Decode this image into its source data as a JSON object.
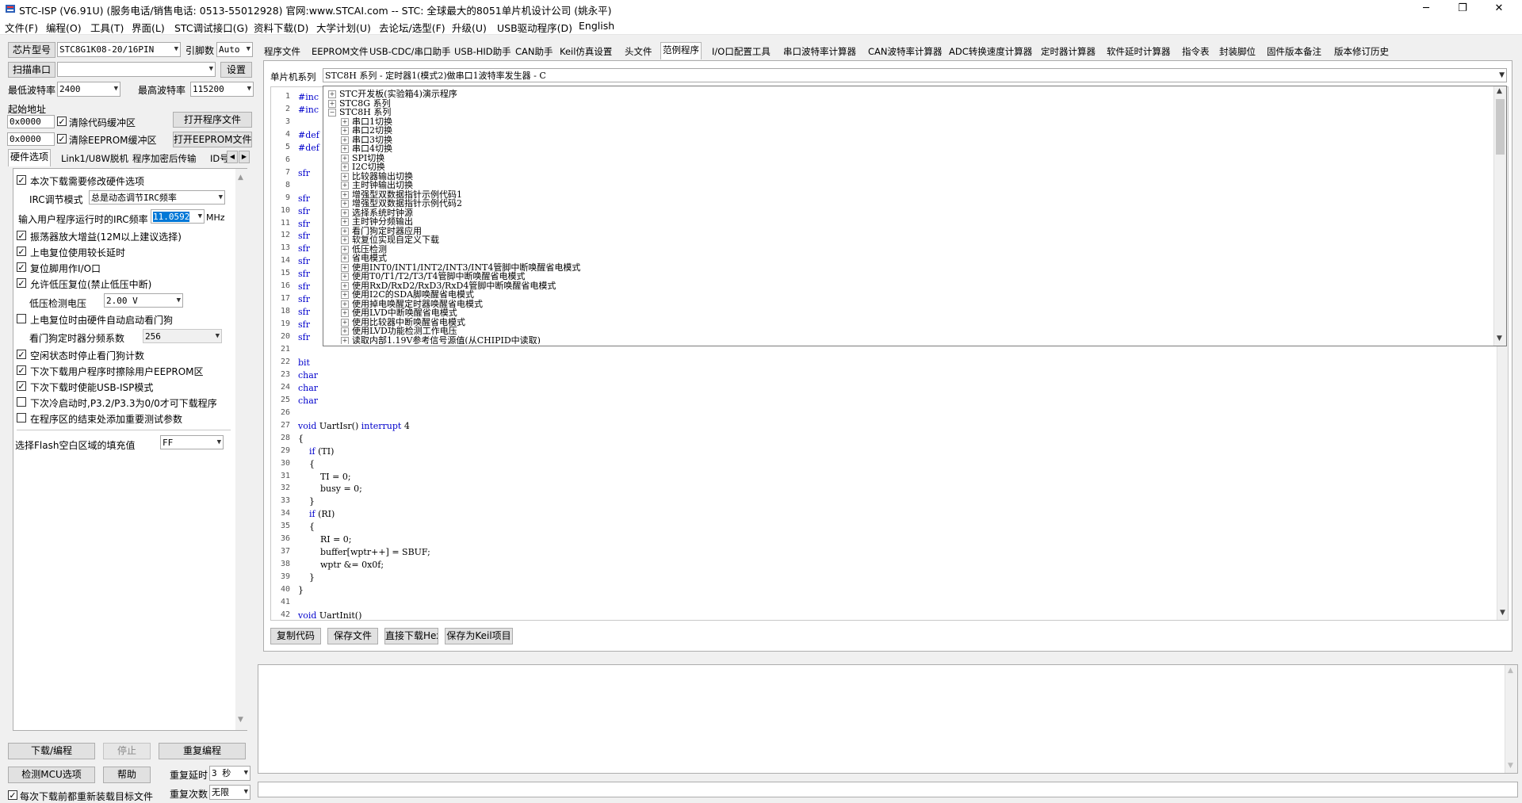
{
  "window": {
    "title": "STC-ISP (V6.91U) (服务电话/销售电话: 0513-55012928) 官网:www.STCAI.com  -- STC: 全球最大的8051单片机设计公司 (姚永平)",
    "minimize": "─",
    "maximize": "❐",
    "close": "✕"
  },
  "menu": [
    "文件(F)",
    "编程(O)",
    "工具(T)",
    "界面(L)",
    "STC调试接口(G)",
    "资料下载(D)",
    "大学计划(U)",
    "去论坛/选型(F)",
    "升级(U)",
    "USB驱动程序(D)",
    "English"
  ],
  "left": {
    "chip_label": "芯片型号",
    "chip_value": "STC8G1K08-20/16PIN",
    "pins_label": "引脚数",
    "pins_value": "Auto",
    "scan_button": "扫描串口",
    "port_value": "",
    "settings_button": "设置",
    "min_baud_label": "最低波特率",
    "min_baud_value": "2400",
    "max_baud_label": "最高波特率",
    "max_baud_value": "115200",
    "start_addr_label": "起始地址",
    "addr1": "0x0000",
    "clear_code": "清除代码缓冲区",
    "open_program": "打开程序文件",
    "addr2": "0x0000",
    "clear_eeprom": "清除EEPROM缓冲区",
    "open_eeprom": "打开EEPROM文件",
    "tabs": [
      "硬件选项",
      "Link1/U8W脱机",
      "程序加密后传输",
      "ID号"
    ],
    "tab_arrows": [
      "◀",
      "▶"
    ],
    "opt_modify_hw": "本次下载需要修改硬件选项",
    "irc_mode_label": "IRC调节模式",
    "irc_mode_value": "总是动态调节IRC频率",
    "irc_freq_label": "输入用户程序运行时的IRC频率",
    "irc_freq_value": "11.0592",
    "irc_freq_unit": "MHz",
    "opt_osc_gain": "振荡器放大增益(12M以上建议选择)",
    "opt_power_delay": "上电复位使用较长延时",
    "opt_reset_io": "复位脚用作I/O口",
    "opt_lvr": "允许低压复位(禁止低压中断)",
    "lvd_label": "低压检测电压",
    "lvd_value": "2.00 V",
    "opt_wdt_hw": "上电复位时由硬件自动启动看门狗",
    "wdt_div_label": "看门狗定时器分频系数",
    "wdt_div_value": "256",
    "opt_idle_wdt": "空闲状态时停止看门狗计数",
    "opt_erase_eeprom": "下次下载用户程序时擦除用户EEPROM区",
    "opt_usb_isp": "下次下载时使能USB-ISP模式",
    "opt_p32p33": "下次冷启动时,P3.2/P3.3为0/0才可下载程序",
    "opt_test_params": "在程序区的结束处添加重要测试参数",
    "flash_fill_label": "选择Flash空白区域的填充值",
    "flash_fill_value": "FF",
    "download_button": "下载/编程",
    "stop_button": "停止",
    "reprogram_button": "重复编程",
    "detect_button": "检测MCU选项",
    "help_button": "帮助",
    "repeat_delay_label": "重复延时",
    "repeat_delay_value": "3 秒",
    "repeat_count_label": "重复次数",
    "repeat_count_value": "无限",
    "reload_label": "每次下载前都重新装载目标文件"
  },
  "right_tabs": [
    "程序文件",
    "EEPROM文件",
    "USB-CDC/串口助手",
    "USB-HID助手",
    "CAN助手",
    "Keil仿真设置",
    "头文件",
    "范例程序",
    "I/O口配置工具",
    "串口波特率计算器",
    "CAN波特率计算器",
    "ADC转换速度计算器",
    "定时器计算器",
    "软件延时计算器",
    "指令表",
    "封装脚位",
    "固件版本备注",
    "版本修订历史"
  ],
  "examples": {
    "series_label": "单片机系列",
    "series_value": "STC8H 系列 - 定时器1(模式2)做串口1波特率发生器 - C",
    "tree": [
      {
        "exp": "+",
        "text": "STC开发板(实验箱4)演示程序",
        "level": 0
      },
      {
        "exp": "+",
        "text": "STC8G 系列",
        "level": 0
      },
      {
        "exp": "−",
        "text": "STC8H 系列",
        "level": 0
      },
      {
        "exp": "+",
        "text": "串口1切换",
        "level": 1
      },
      {
        "exp": "+",
        "text": "串口2切换",
        "level": 1
      },
      {
        "exp": "+",
        "text": "串口3切换",
        "level": 1
      },
      {
        "exp": "+",
        "text": "串口4切换",
        "level": 1
      },
      {
        "exp": "+",
        "text": "SPI切换",
        "level": 1
      },
      {
        "exp": "+",
        "text": "I2C切换",
        "level": 1
      },
      {
        "exp": "+",
        "text": "比较器输出切换",
        "level": 1
      },
      {
        "exp": "+",
        "text": "主时钟输出切换",
        "level": 1
      },
      {
        "exp": "+",
        "text": "增强型双数据指针示例代码1",
        "level": 1
      },
      {
        "exp": "+",
        "text": "增强型双数据指针示例代码2",
        "level": 1
      },
      {
        "exp": "+",
        "text": "选择系统时钟源",
        "level": 1
      },
      {
        "exp": "+",
        "text": "主时钟分频输出",
        "level": 1
      },
      {
        "exp": "+",
        "text": "看门狗定时器应用",
        "level": 1
      },
      {
        "exp": "+",
        "text": "软复位实现自定义下载",
        "level": 1
      },
      {
        "exp": "+",
        "text": "低压检测",
        "level": 1
      },
      {
        "exp": "+",
        "text": "省电模式",
        "level": 1
      },
      {
        "exp": "+",
        "text": "使用INT0/INT1/INT2/INT3/INT4管脚中断唤醒省电模式",
        "level": 1
      },
      {
        "exp": "+",
        "text": "使用T0/T1/T2/T3/T4管脚中断唤醒省电模式",
        "level": 1
      },
      {
        "exp": "+",
        "text": "使用RxD/RxD2/RxD3/RxD4管脚中断唤醒省电模式",
        "level": 1
      },
      {
        "exp": "+",
        "text": "使用I2C的SDA脚唤醒省电模式",
        "level": 1
      },
      {
        "exp": "+",
        "text": "使用掉电唤醒定时器唤醒省电模式",
        "level": 1
      },
      {
        "exp": "+",
        "text": "使用LVD中断唤醒省电模式",
        "level": 1
      },
      {
        "exp": "+",
        "text": "使用比较器中断唤醒省电模式",
        "level": 1
      },
      {
        "exp": "+",
        "text": "使用LVD功能检测工作电压",
        "level": 1
      },
      {
        "exp": "+",
        "text": "读取内部1.19V参考信号源值(从CHIPID中读取)",
        "level": 1
      }
    ],
    "code_lines": [
      {
        "n": "1",
        "t": "#inc",
        "kw": true
      },
      {
        "n": "2",
        "t": "#inc",
        "kw": true
      },
      {
        "n": "3",
        "t": ""
      },
      {
        "n": "4",
        "t": "#def",
        "kw": true
      },
      {
        "n": "5",
        "t": "#def",
        "kw": true
      },
      {
        "n": "6",
        "t": ""
      },
      {
        "n": "7",
        "t": "sfr",
        "kw": true
      },
      {
        "n": "8",
        "t": ""
      },
      {
        "n": "9",
        "t": "sfr",
        "kw": true
      },
      {
        "n": "10",
        "t": "sfr",
        "kw": true
      },
      {
        "n": "11",
        "t": "sfr",
        "kw": true
      },
      {
        "n": "12",
        "t": "sfr",
        "kw": true
      },
      {
        "n": "13",
        "t": "sfr",
        "kw": true
      },
      {
        "n": "14",
        "t": "sfr",
        "kw": true
      },
      {
        "n": "15",
        "t": "sfr",
        "kw": true
      },
      {
        "n": "16",
        "t": "sfr",
        "kw": true
      },
      {
        "n": "17",
        "t": "sfr",
        "kw": true
      },
      {
        "n": "18",
        "t": "sfr",
        "kw": true
      },
      {
        "n": "19",
        "t": "sfr",
        "kw": true
      },
      {
        "n": "20",
        "t": "sfr",
        "kw": true
      },
      {
        "n": "21",
        "t": ""
      },
      {
        "n": "22",
        "t": "bit",
        "kw": true
      },
      {
        "n": "23",
        "t": "char",
        "kw": true
      },
      {
        "n": "24",
        "t": "char",
        "kw": true
      },
      {
        "n": "25",
        "t": "char",
        "kw": true
      },
      {
        "n": "26",
        "t": ""
      },
      {
        "n": "27",
        "t": "void UartIsr() interrupt 4",
        "kw": false
      },
      {
        "n": "28",
        "t": "{"
      },
      {
        "n": "29",
        "t": "    if (TI)"
      },
      {
        "n": "30",
        "t": "    {"
      },
      {
        "n": "31",
        "t": "        TI = 0;"
      },
      {
        "n": "32",
        "t": "        busy = 0;"
      },
      {
        "n": "33",
        "t": "    }"
      },
      {
        "n": "34",
        "t": "    if (RI)"
      },
      {
        "n": "35",
        "t": "    {"
      },
      {
        "n": "36",
        "t": "        RI = 0;"
      },
      {
        "n": "37",
        "t": "        buffer[wptr++] = SBUF;"
      },
      {
        "n": "38",
        "t": "        wptr &= 0x0f;"
      },
      {
        "n": "39",
        "t": "    }"
      },
      {
        "n": "40",
        "t": "}"
      },
      {
        "n": "41",
        "t": ""
      },
      {
        "n": "42",
        "t": "void UartInit()"
      }
    ],
    "copy_button": "复制代码",
    "save_button": "保存文件",
    "download_hex_button": "直接下载Hex",
    "save_keil_button": "保存为Keil项目"
  },
  "colors": {
    "accent_tab": "#ffffff",
    "keyword": "#0000cc",
    "selection": "#0078d7"
  }
}
